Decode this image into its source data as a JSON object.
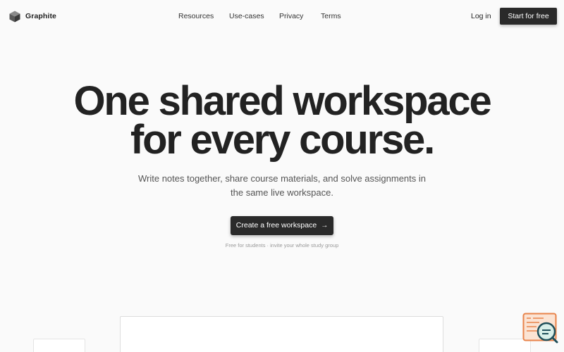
{
  "brand": {
    "name": "Graphite",
    "logo_icon": "cube-icon"
  },
  "nav": {
    "items": [
      {
        "label": "Resources"
      },
      {
        "label": "Use-cases"
      },
      {
        "label": "Privacy"
      },
      {
        "label": "Terms"
      }
    ],
    "login_label": "Log in",
    "start_label": "Start for free"
  },
  "hero": {
    "title_line1": "One shared workspace",
    "title_line2": "for every course.",
    "subtitle": "Write notes together, share course materials, and solve assignments in the same live workspace.",
    "cta_label": "Create a free workspace",
    "cta_icon": "arrow-right-icon",
    "note": "Free for students · invite your whole study group"
  },
  "widget": {
    "icon": "search-chat-icon"
  },
  "colors": {
    "background": "#fafafa",
    "text": "#222222",
    "button_bg": "#2a2a2a",
    "accent_orange": "#e8834a",
    "accent_teal": "#1f4f5a"
  }
}
